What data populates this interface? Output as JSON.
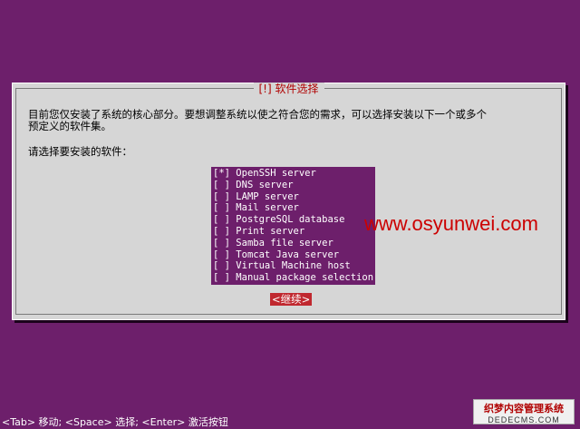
{
  "dialog": {
    "title": "[!] 软件选择",
    "description_line1": "目前您仅安装了系统的核心部分。要想调整系统以使之符合您的需求，可以选择安装以下一个或多个",
    "description_line2": "预定义的软件集。",
    "prompt": "请选择要安装的软件：",
    "items": [
      {
        "mark": "[*]",
        "label": "OpenSSH server"
      },
      {
        "mark": "[ ]",
        "label": "DNS server"
      },
      {
        "mark": "[ ]",
        "label": "LAMP server"
      },
      {
        "mark": "[ ]",
        "label": "Mail server"
      },
      {
        "mark": "[ ]",
        "label": "PostgreSQL database"
      },
      {
        "mark": "[ ]",
        "label": "Print server"
      },
      {
        "mark": "[ ]",
        "label": "Samba file server"
      },
      {
        "mark": "[ ]",
        "label": "Tomcat Java server"
      },
      {
        "mark": "[ ]",
        "label": "Virtual Machine host"
      },
      {
        "mark": "[ ]",
        "label": "Manual package selection"
      }
    ],
    "continue_label": "<继续>"
  },
  "watermark": "www.osyunwei.com",
  "statusbar": "<Tab> 移动; <Space> 选择; <Enter> 激活按钮",
  "logo": {
    "line1": "织梦内容管理系统",
    "line2": "DEDECMS.COM"
  },
  "colors": {
    "background": "#6d1f6b",
    "dialog": "#d6d6d6",
    "title": "#b00000",
    "button": "#c0282f"
  }
}
